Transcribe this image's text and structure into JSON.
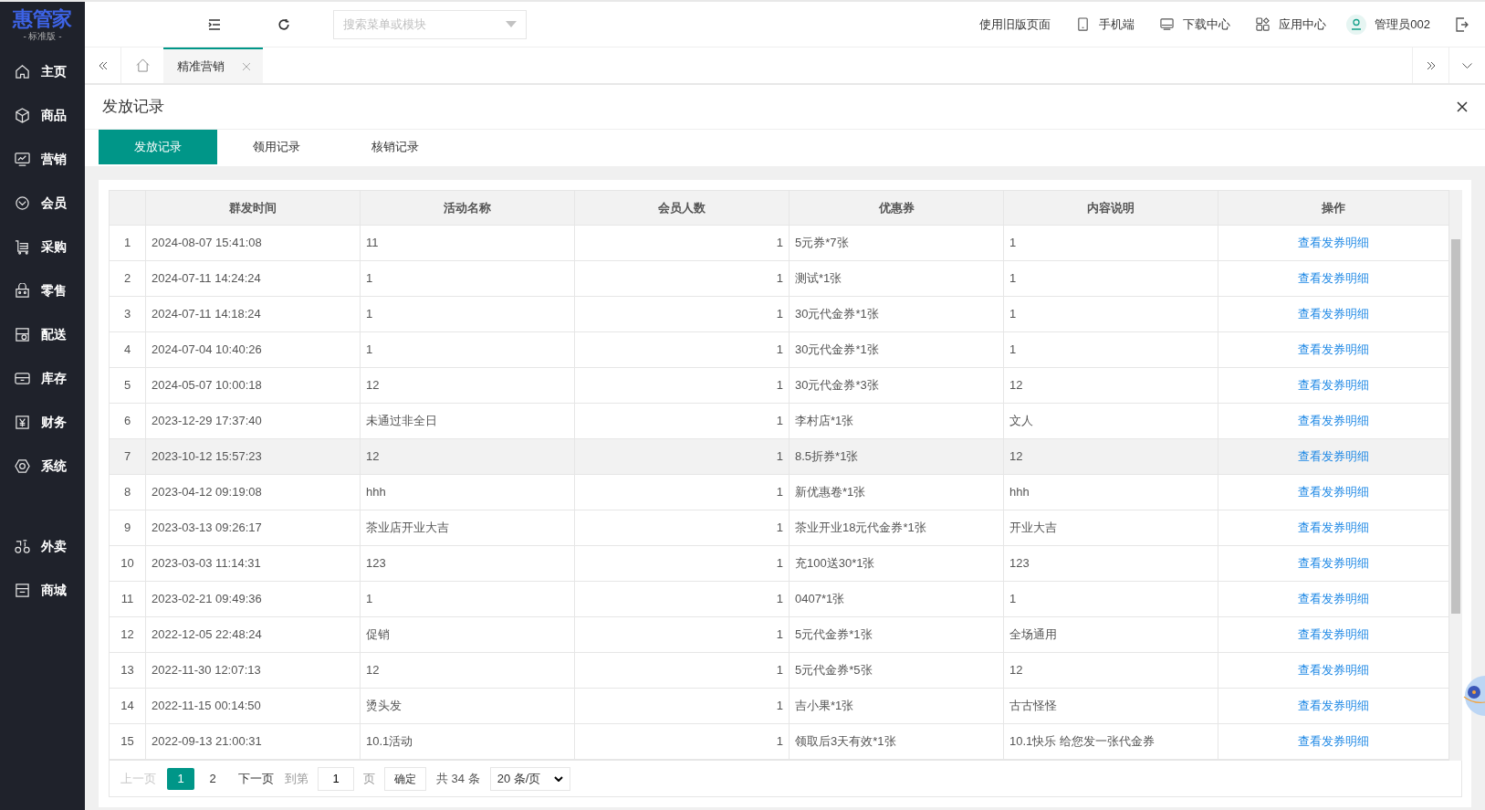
{
  "logo": {
    "name": "惠管家",
    "edition": "- 标准版 -"
  },
  "sidebar": {
    "items": [
      {
        "label": "主页",
        "kind": "home"
      },
      {
        "label": "商品",
        "kind": "box"
      },
      {
        "label": "营销",
        "kind": "chart"
      },
      {
        "label": "会员",
        "kind": "diamond"
      },
      {
        "label": "采购",
        "kind": "cart"
      },
      {
        "label": "零售",
        "kind": "bag"
      },
      {
        "label": "配送",
        "kind": "store"
      },
      {
        "label": "库存",
        "kind": "archive"
      },
      {
        "label": "财务",
        "kind": "yen"
      },
      {
        "label": "系统",
        "kind": "gear"
      }
    ],
    "extra_items": [
      {
        "label": "外卖",
        "kind": "bike"
      },
      {
        "label": "商城",
        "kind": "shop"
      }
    ]
  },
  "header": {
    "search": {
      "placeholder": "搜索菜单或模块"
    },
    "links": [
      {
        "label": "使用旧版页面",
        "kind": "text"
      },
      {
        "label": "手机端",
        "kind": "phone"
      },
      {
        "label": "下载中心",
        "kind": "monitor"
      },
      {
        "label": "应用中心",
        "kind": "apps"
      }
    ],
    "user": "管理员002"
  },
  "open_tabs": [
    {
      "label": "精准营销",
      "selected": true
    }
  ],
  "page": {
    "title": "发放记录",
    "tabs": [
      {
        "label": "发放记录",
        "selected": true
      },
      {
        "label": "领用记录",
        "selected": false
      },
      {
        "label": "核销记录",
        "selected": false
      }
    ],
    "table": {
      "columns": [
        "群发时间",
        "活动名称",
        "会员人数",
        "优惠券",
        "内容说明",
        "操作"
      ],
      "rows": [
        {
          "index": "1",
          "time": "2024-08-07 15:41:08",
          "name": "11",
          "members": "1",
          "coupon": "5元券*7张",
          "desc": "1",
          "action": "查看发券明细",
          "selected": false
        },
        {
          "index": "2",
          "time": "2024-07-11 14:24:24",
          "name": "1",
          "members": "1",
          "coupon": "测试*1张",
          "desc": "1",
          "action": "查看发券明细",
          "selected": false
        },
        {
          "index": "3",
          "time": "2024-07-11 14:18:24",
          "name": "1",
          "members": "1",
          "coupon": "30元代金券*1张",
          "desc": "1",
          "action": "查看发券明细",
          "selected": false
        },
        {
          "index": "4",
          "time": "2024-07-04 10:40:26",
          "name": "1",
          "members": "1",
          "coupon": "30元代金券*1张",
          "desc": "1",
          "action": "查看发券明细",
          "selected": false
        },
        {
          "index": "5",
          "time": "2024-05-07 10:00:18",
          "name": "12",
          "members": "1",
          "coupon": "30元代金券*3张",
          "desc": "12",
          "action": "查看发券明细",
          "selected": false
        },
        {
          "index": "6",
          "time": "2023-12-29 17:37:40",
          "name": "未通过非全日",
          "members": "1",
          "coupon": "李村店*1张",
          "desc": "文人",
          "action": "查看发券明细",
          "selected": false
        },
        {
          "index": "7",
          "time": "2023-10-12 15:57:23",
          "name": "12",
          "members": "1",
          "coupon": "8.5折券*1张",
          "desc": "12",
          "action": "查看发券明细",
          "selected": true
        },
        {
          "index": "8",
          "time": "2023-04-12 09:19:08",
          "name": "hhh",
          "members": "1",
          "coupon": "新优惠卷*1张",
          "desc": "hhh",
          "action": "查看发券明细",
          "selected": false
        },
        {
          "index": "9",
          "time": "2023-03-13 09:26:17",
          "name": "茶业店开业大吉",
          "members": "1",
          "coupon": "茶业开业18元代金券*1张",
          "desc": "开业大吉",
          "action": "查看发券明细",
          "selected": false
        },
        {
          "index": "10",
          "time": "2023-03-03 11:14:31",
          "name": "123",
          "members": "1",
          "coupon": "充100送30*1张",
          "desc": "123",
          "action": "查看发券明细",
          "selected": false
        },
        {
          "index": "11",
          "time": "2023-02-21 09:49:36",
          "name": "1",
          "members": "1",
          "coupon": "0407*1张",
          "desc": "1",
          "action": "查看发券明细",
          "selected": false
        },
        {
          "index": "12",
          "time": "2022-12-05 22:48:24",
          "name": "促销",
          "members": "1",
          "coupon": "5元代金券*1张",
          "desc": "全场通用",
          "action": "查看发券明细",
          "selected": false
        },
        {
          "index": "13",
          "time": "2022-11-30 12:07:13",
          "name": "12",
          "members": "1",
          "coupon": "5元代金券*5张",
          "desc": "12",
          "action": "查看发券明细",
          "selected": false
        },
        {
          "index": "14",
          "time": "2022-11-15 00:14:50",
          "name": "烫头发",
          "members": "1",
          "coupon": "吉小果*1张",
          "desc": "古古怪怪",
          "action": "查看发券明细",
          "selected": false
        },
        {
          "index": "15",
          "time": "2022-09-13 21:00:31",
          "name": "10.1活动",
          "members": "1",
          "coupon": "领取后3天有效*1张",
          "desc": "10.1快乐 给您发一张代金券",
          "action": "查看发券明细",
          "selected": false
        }
      ]
    },
    "pagination": {
      "prev": "上一页",
      "pages": [
        {
          "label": "1",
          "selected": true
        },
        {
          "label": "2",
          "selected": false
        }
      ],
      "next": "下一页",
      "goto_label": "到第",
      "goto_value": "1",
      "page_unit": "页",
      "confirm": "确定",
      "total": "共 34 条",
      "page_size": "20 条/页"
    }
  }
}
